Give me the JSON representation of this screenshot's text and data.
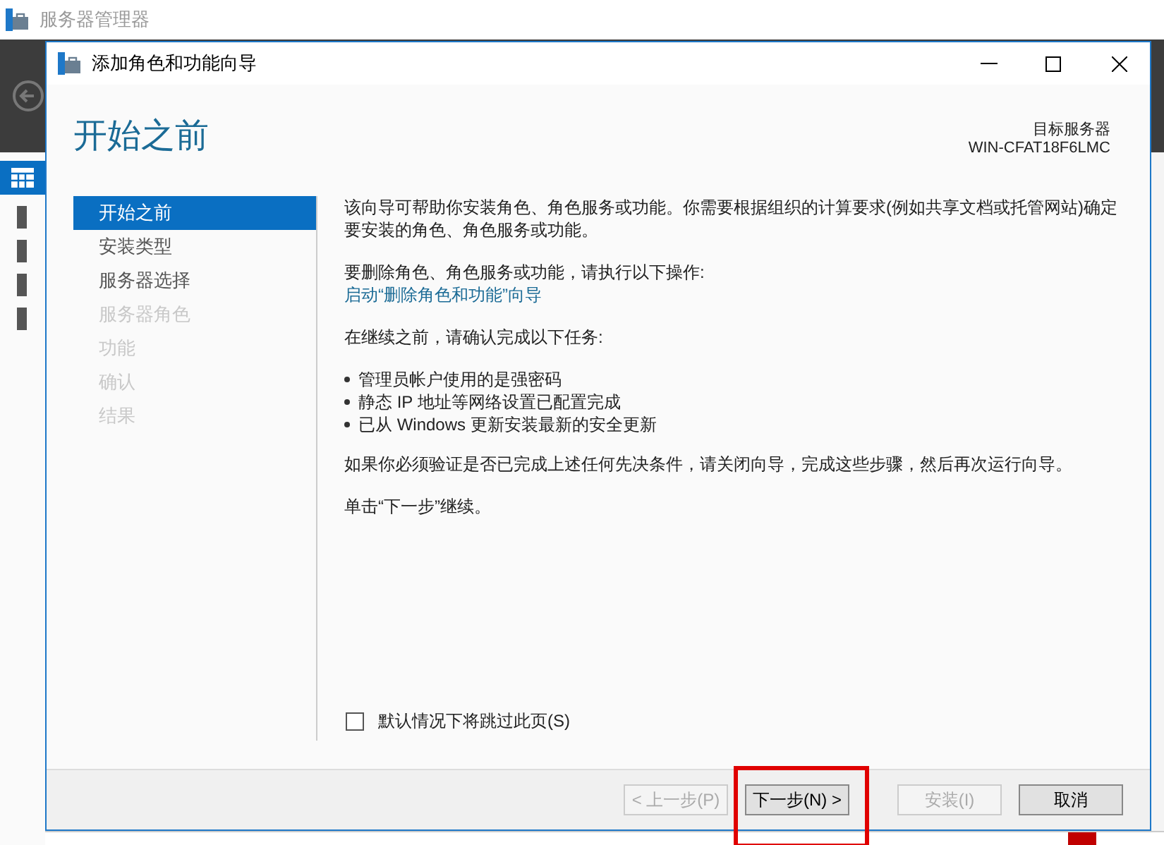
{
  "app": {
    "title": "服务器管理器"
  },
  "dialog": {
    "title": "添加角色和功能向导",
    "heading": "开始之前",
    "target_label": "目标服务器",
    "target_server": "WIN-CFAT18F6LMC",
    "steps": [
      {
        "label": "开始之前",
        "selected": true,
        "disabled": false
      },
      {
        "label": "安装类型",
        "selected": false,
        "disabled": false
      },
      {
        "label": "服务器选择",
        "selected": false,
        "disabled": false
      },
      {
        "label": "服务器角色",
        "selected": false,
        "disabled": true
      },
      {
        "label": "功能",
        "selected": false,
        "disabled": true
      },
      {
        "label": "确认",
        "selected": false,
        "disabled": true
      },
      {
        "label": "结果",
        "selected": false,
        "disabled": true
      }
    ],
    "intro": "该向导可帮助你安装角色、角色服务或功能。你需要根据组织的计算要求(例如共享文档或托管网站)确定要安装的角色、角色服务或功能。",
    "remove_text": "要删除角色、角色服务或功能，请执行以下操作:",
    "remove_link": "启动“删除角色和功能”向导",
    "tasks_intro": "在继续之前，请确认完成以下任务:",
    "tasks": [
      "管理员帐户使用的是强密码",
      "静态 IP 地址等网络设置已配置完成",
      "已从 Windows 更新安装最新的安全更新"
    ],
    "verify_text": "如果你必须验证是否已完成上述任何先决条件，请关闭向导，完成这些步骤，然后再次运行向导。",
    "continue_text": "单击“下一步”继续。",
    "skip_checkbox": {
      "label": "默认情况下将跳过此页(S)",
      "checked": false
    },
    "buttons": [
      {
        "label": "< 上一步(P)",
        "disabled": true,
        "highlighted": false
      },
      {
        "label": "下一步(N) >",
        "disabled": false,
        "highlighted": true
      },
      {
        "label": "安装(I)",
        "disabled": true,
        "highlighted": false
      },
      {
        "label": "取消",
        "disabled": false,
        "highlighted": false
      }
    ]
  }
}
